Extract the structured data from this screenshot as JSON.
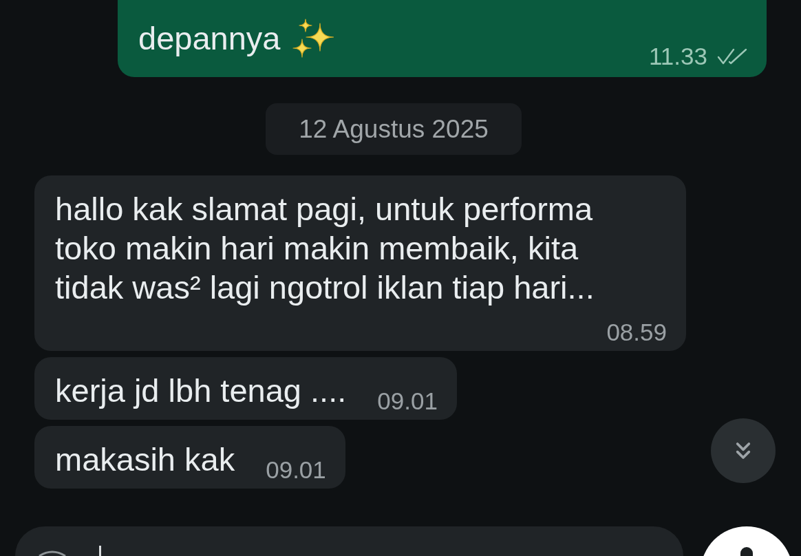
{
  "messages": [
    {
      "kind": "outgoing",
      "text": "depannya",
      "emoji": true,
      "time": "11.33",
      "read": false
    },
    {
      "kind": "date",
      "text": "12 Agustus 2025"
    },
    {
      "kind": "incoming",
      "text": "hallo kak slamat pagi, untuk performa toko makin hari makin membaik, kita tidak was² lagi ngotrol iklan tiap hari...",
      "time": "08.59"
    },
    {
      "kind": "incoming",
      "text": "kerja jd lbh tenag ....",
      "time": "09.01"
    },
    {
      "kind": "incoming",
      "text": "makasih kak",
      "time": "09.01"
    }
  ]
}
